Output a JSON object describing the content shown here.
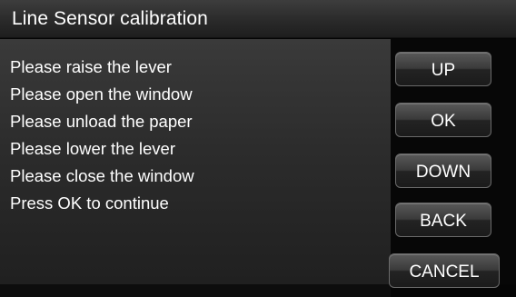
{
  "window": {
    "title": "Line Sensor calibration"
  },
  "instructions": [
    "Please raise the lever",
    "Please open the window",
    "Please unload the paper",
    "Please lower the lever",
    "Please close the window",
    "Press OK to continue"
  ],
  "buttons": {
    "up": "UP",
    "ok": "OK",
    "down": "DOWN",
    "back": "BACK",
    "cancel": "CANCEL"
  }
}
